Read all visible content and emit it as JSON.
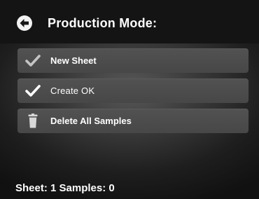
{
  "header": {
    "title": "Production Mode:",
    "back_icon": "arrow-left-circle-icon"
  },
  "menu": {
    "items": [
      {
        "label": "New Sheet",
        "icon": "checkmark-icon",
        "icon_color": "#c4c4c4"
      },
      {
        "label": "Create OK",
        "icon": "checkmark-icon",
        "icon_color": "#ffffff"
      },
      {
        "label": "Delete All Samples",
        "icon": "trash-icon",
        "icon_color": "#d8d8d8"
      }
    ]
  },
  "status": {
    "text": "Sheet: 1 Samples: 0"
  },
  "colors": {
    "header_bg": "#141414",
    "item_bg": "#4d4d4d",
    "text": "#ffffff"
  }
}
